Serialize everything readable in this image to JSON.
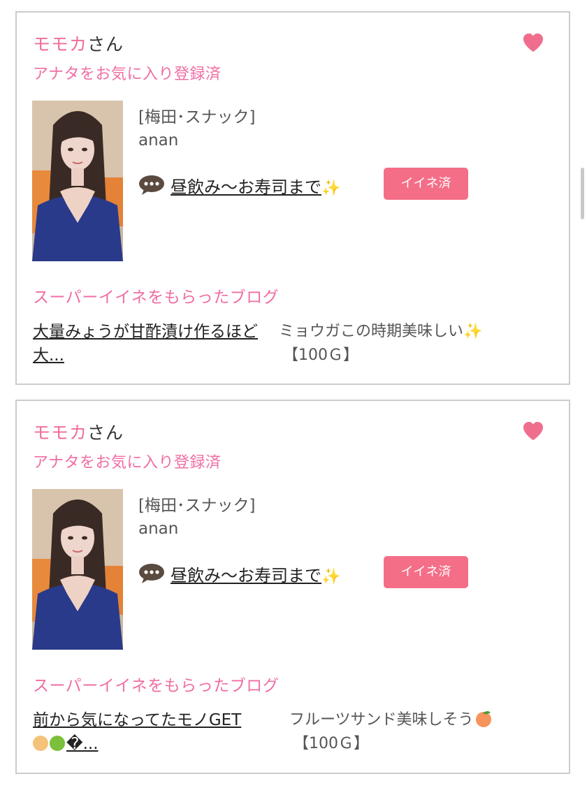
{
  "cards": [
    {
      "user_name": "モモカ",
      "user_suffix": "さん",
      "favorite_status": "アナタをお気に入り登録済",
      "favorite_icon": "heart-icon",
      "shop": "[梅田･スナック]",
      "cast_name": "anan",
      "comment_icon": "speech-bubble-icon",
      "comment": "昼飲み〜お寿司まで",
      "comment_emoji": "✨",
      "like_label": "イイネ済",
      "blog_heading": "スーパーイイネをもらったブログ",
      "blog_title": "大量みょうが甘酢漬け作るほど大...",
      "blog_desc": "ミョウガこの時期美味しい✨",
      "blog_price": "【100Ｇ】"
    },
    {
      "user_name": "モモカ",
      "user_suffix": "さん",
      "favorite_status": "アナタをお気に入り登録済",
      "favorite_icon": "heart-icon",
      "shop": "[梅田･スナック]",
      "cast_name": "anan",
      "comment_icon": "speech-bubble-icon",
      "comment": "昼飲み〜お寿司まで",
      "comment_emoji": "✨",
      "like_label": "イイネ済",
      "blog_heading": "スーパーイイネをもらったブログ",
      "blog_title": "前から気になってたモノGET",
      "blog_title_tail": "�...",
      "blog_desc": "フルーツサンド美味しそう",
      "blog_desc_emoji": "peach-emoji",
      "blog_price": "【100Ｇ】"
    }
  ],
  "colors": {
    "accent_pink": "#ef6ea4",
    "button_pink": "#f46e87",
    "border": "#cccccc"
  }
}
